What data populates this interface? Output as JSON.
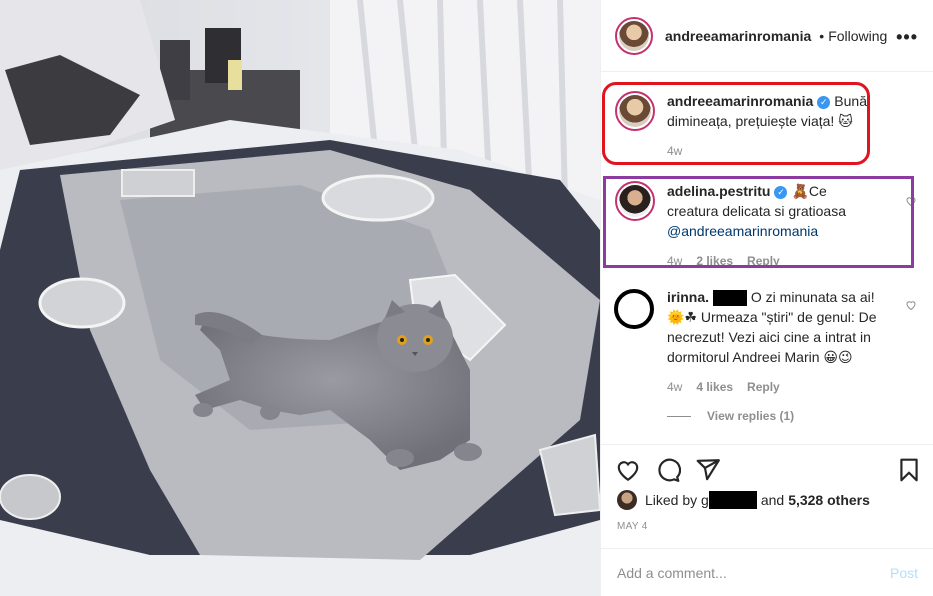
{
  "header": {
    "username": "andreeamarinromania",
    "separator": "•",
    "follow_status": "Following",
    "more_label": "•••"
  },
  "comments": [
    {
      "username": "andreeamarinromania",
      "verified": true,
      "text": "Bună dimineața, prețuiește viața! 🐱",
      "age": "4w"
    },
    {
      "username": "adelina.pestritu",
      "verified": true,
      "text": "🧸Ce creatura delicata si gratioasa",
      "mention": "@andreeamarinromania",
      "age": "4w",
      "likes": "2 likes",
      "reply": "Reply"
    },
    {
      "username": "irinna.",
      "text": "O zi minunata sa ai! 🌞☘ Urmeaza \"știri\" de genul: De necrezut! Vezi aici cine a intrat in dormitorul Andreei Marin 😀😉",
      "age": "4w",
      "likes": "4 likes",
      "reply": "Reply",
      "view_replies": "View replies (1)"
    }
  ],
  "likes": {
    "prefix": "Liked by g",
    "suffix": "and",
    "count": "5,328 others"
  },
  "date": "MAY 4",
  "add_comment": {
    "placeholder": "Add a comment...",
    "post_label": "Post"
  },
  "icons": {
    "like": "heart-icon",
    "comment": "comment-icon",
    "share": "paper-plane-icon",
    "save": "bookmark-icon"
  },
  "colors": {
    "story_ring": "#c4316f",
    "verified": "#3897f0",
    "post_disabled": "#b2dffc",
    "annotation_red": "#e0141e",
    "annotation_purple": "#8c3ca0"
  }
}
